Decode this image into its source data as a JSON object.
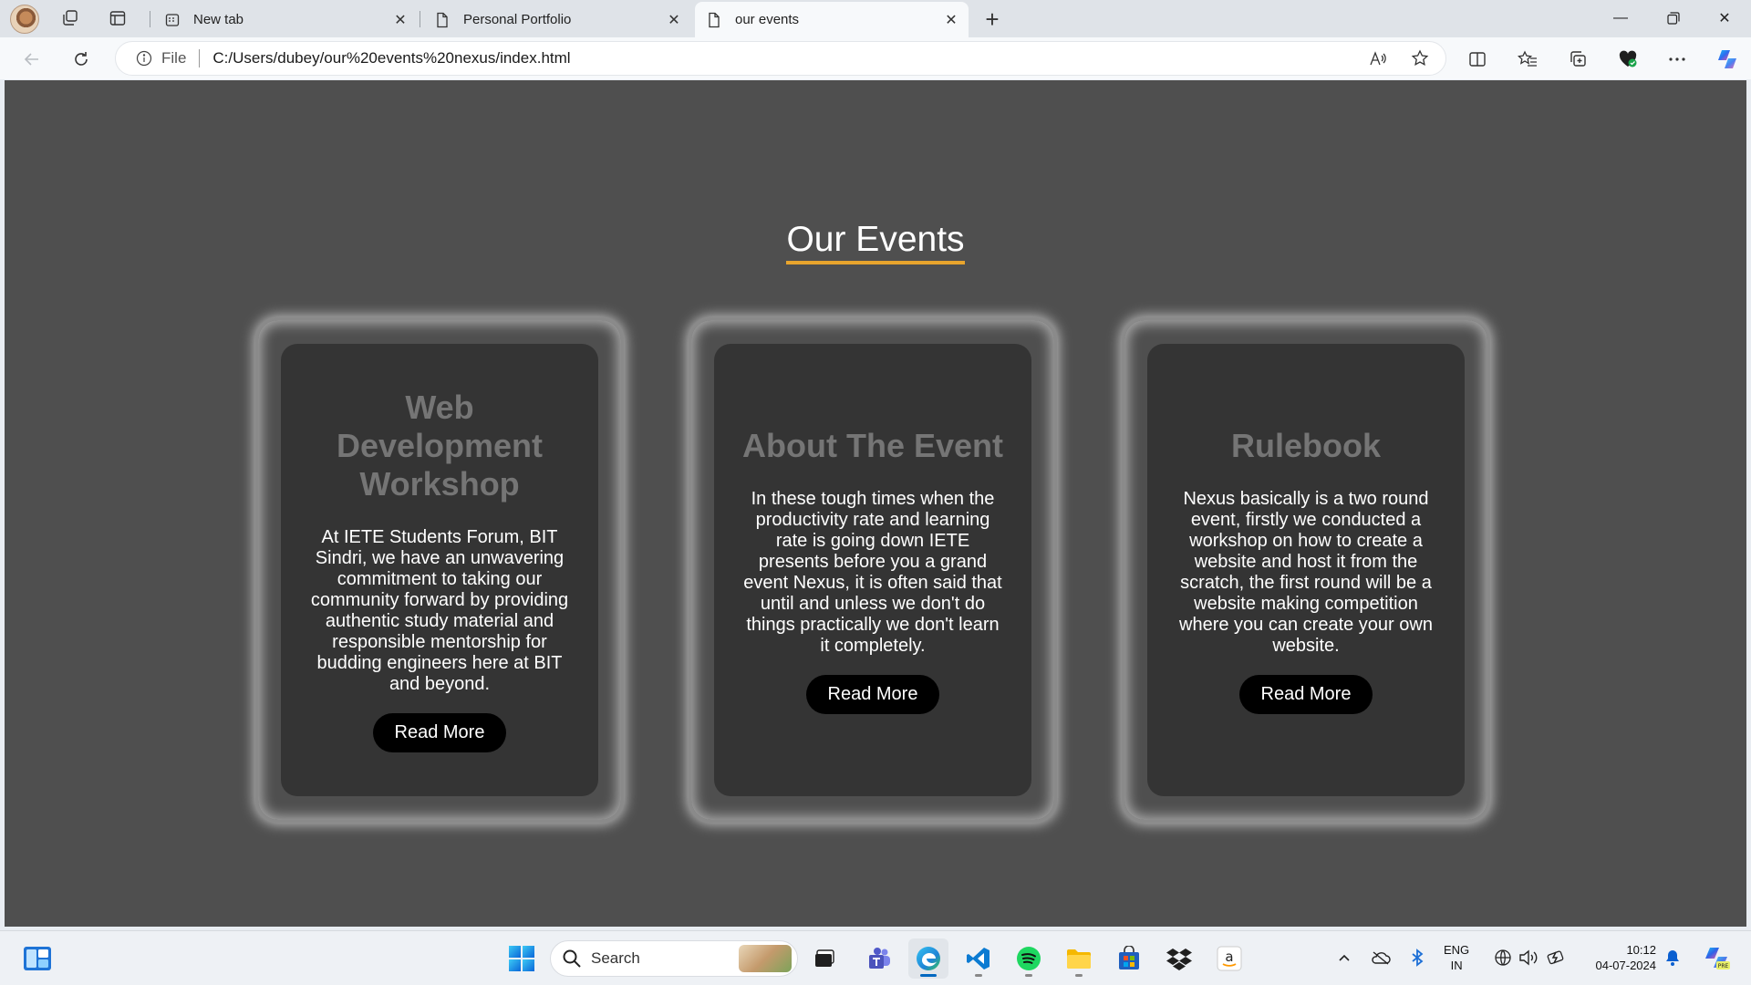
{
  "browser": {
    "tabs": [
      {
        "title": "New tab",
        "active": false
      },
      {
        "title": "Personal Portfolio",
        "active": false
      },
      {
        "title": "our events",
        "active": true
      }
    ],
    "address": {
      "scheme_label": "File",
      "url": "C:/Users/dubey/our%20events%20nexus/index.html"
    }
  },
  "page": {
    "heading": "Our Events",
    "cards": [
      {
        "title": "Web Development Workshop",
        "text": "At IETE Students Forum, BIT Sindri, we have an unwavering commitment to taking our community forward by providing authentic study material and responsible mentorship for budding engineers here at BIT and beyond.",
        "button": "Read More"
      },
      {
        "title": "About The Event",
        "text": "In these tough times when the productivity rate and learning rate is going down IETE presents before you a grand event Nexus, it is often said that until and unless we don't do things practically we don't learn it completely.",
        "button": "Read More"
      },
      {
        "title": "Rulebook",
        "text": "Nexus basically is a two round event, firstly we conducted a workshop on how to create a website and host it from the scratch, the first round will be a website making competition where you can create your own website.",
        "button": "Read More"
      }
    ]
  },
  "taskbar": {
    "search_label": "Search",
    "language": {
      "line1": "ENG",
      "line2": "IN"
    },
    "clock": {
      "time": "10:12",
      "date": "04-07-2024"
    }
  },
  "colors": {
    "page_bg": "#4f4f4f",
    "card_bg": "#343434",
    "heading_underline": "#e8a52d",
    "card_title": "#757575",
    "button_bg": "#000000"
  }
}
